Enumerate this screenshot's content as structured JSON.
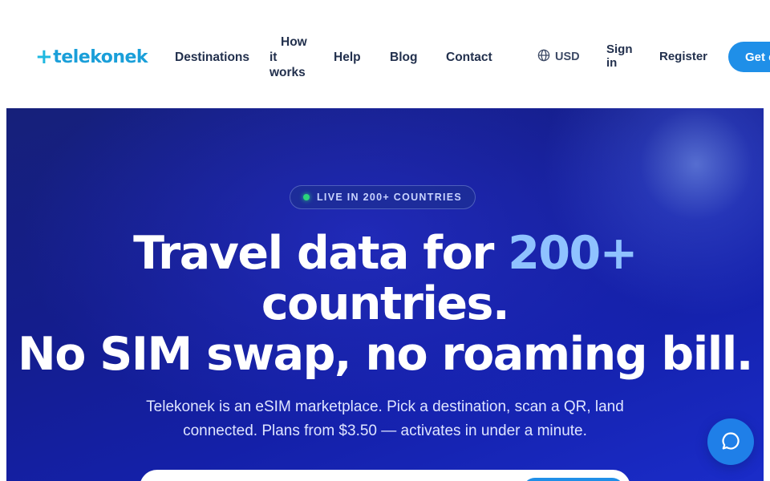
{
  "brand": {
    "name": "telekonek",
    "logo_mark": "+",
    "logo_text": "telekonek",
    "color": "#1a9fd9"
  },
  "nav": {
    "destinations": "Destinations",
    "how_line1": "How",
    "how_line2": "it",
    "how_line3": "works",
    "help": "Help",
    "blog": "Blog",
    "contact": "Contact"
  },
  "header_actions": {
    "currency_icon": "globe-icon",
    "currency": "USD",
    "signin_line1": "Sign",
    "signin_line2": "in",
    "register": "Register",
    "cta": "Get e"
  },
  "hero": {
    "badge": "LIVE IN 200+ COUNTRIES",
    "headline_part1": "Travel data for ",
    "headline_accent": "200+",
    "headline_line2": "countries.",
    "headline_line3": "No SIM swap, no roaming bill.",
    "subtitle": "Telekonek is an eSIM marketplace. Pick a destination, scan a QR, land connected. Plans from $3.50 — activates in under a minute."
  },
  "chat": {
    "icon": "chat-bubble-icon"
  },
  "colors": {
    "accent": "#1f8fe8",
    "hero_bg": "#1420a8",
    "headline_accent": "#8fc2ff",
    "live_dot": "#2bd57b"
  }
}
